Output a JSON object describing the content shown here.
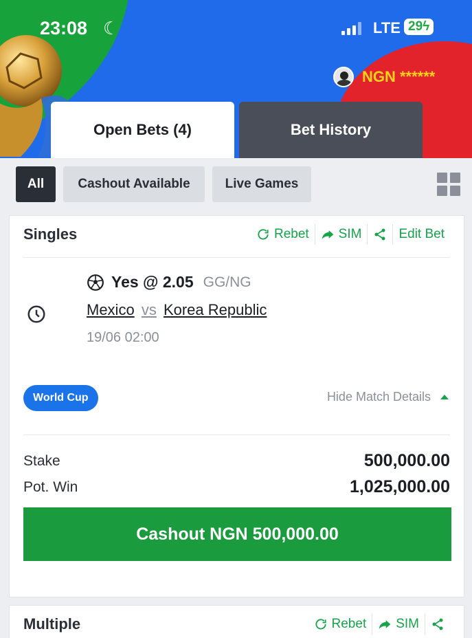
{
  "status_bar": {
    "time": "23:08",
    "network": "LTE",
    "battery": "29"
  },
  "header": {
    "account_text": "NGN ******"
  },
  "tabs": [
    {
      "label": "Open Bets (4)"
    },
    {
      "label": "Bet History"
    }
  ],
  "filters": [
    {
      "label": "All"
    },
    {
      "label": "Cashout Available"
    },
    {
      "label": "Live Games"
    }
  ],
  "singles": {
    "title": "Singles",
    "actions": {
      "rebet": "Rebet",
      "sim": "SIM",
      "edit": "Edit Bet"
    },
    "pick": "Yes @ 2.05",
    "market": "GG/NG",
    "home_team": "Mexico",
    "vs": "vs",
    "away_team": "Korea Republic",
    "datetime": "19/06 02:00",
    "competition": "World Cup",
    "details_toggle": "Hide Match Details",
    "stake_label": "Stake",
    "stake_value": "500,000.00",
    "pot_win_label": "Pot. Win",
    "pot_win_value": "1,025,000.00",
    "cashout_label": "Cashout NGN 500,000.00"
  },
  "multiple": {
    "title": "Multiple",
    "actions": {
      "rebet": "Rebet",
      "sim": "SIM"
    }
  },
  "colors": {
    "accent_green": "#16a34a",
    "cashout_green": "#1a9b3d",
    "badge_blue": "#1a73e8"
  }
}
